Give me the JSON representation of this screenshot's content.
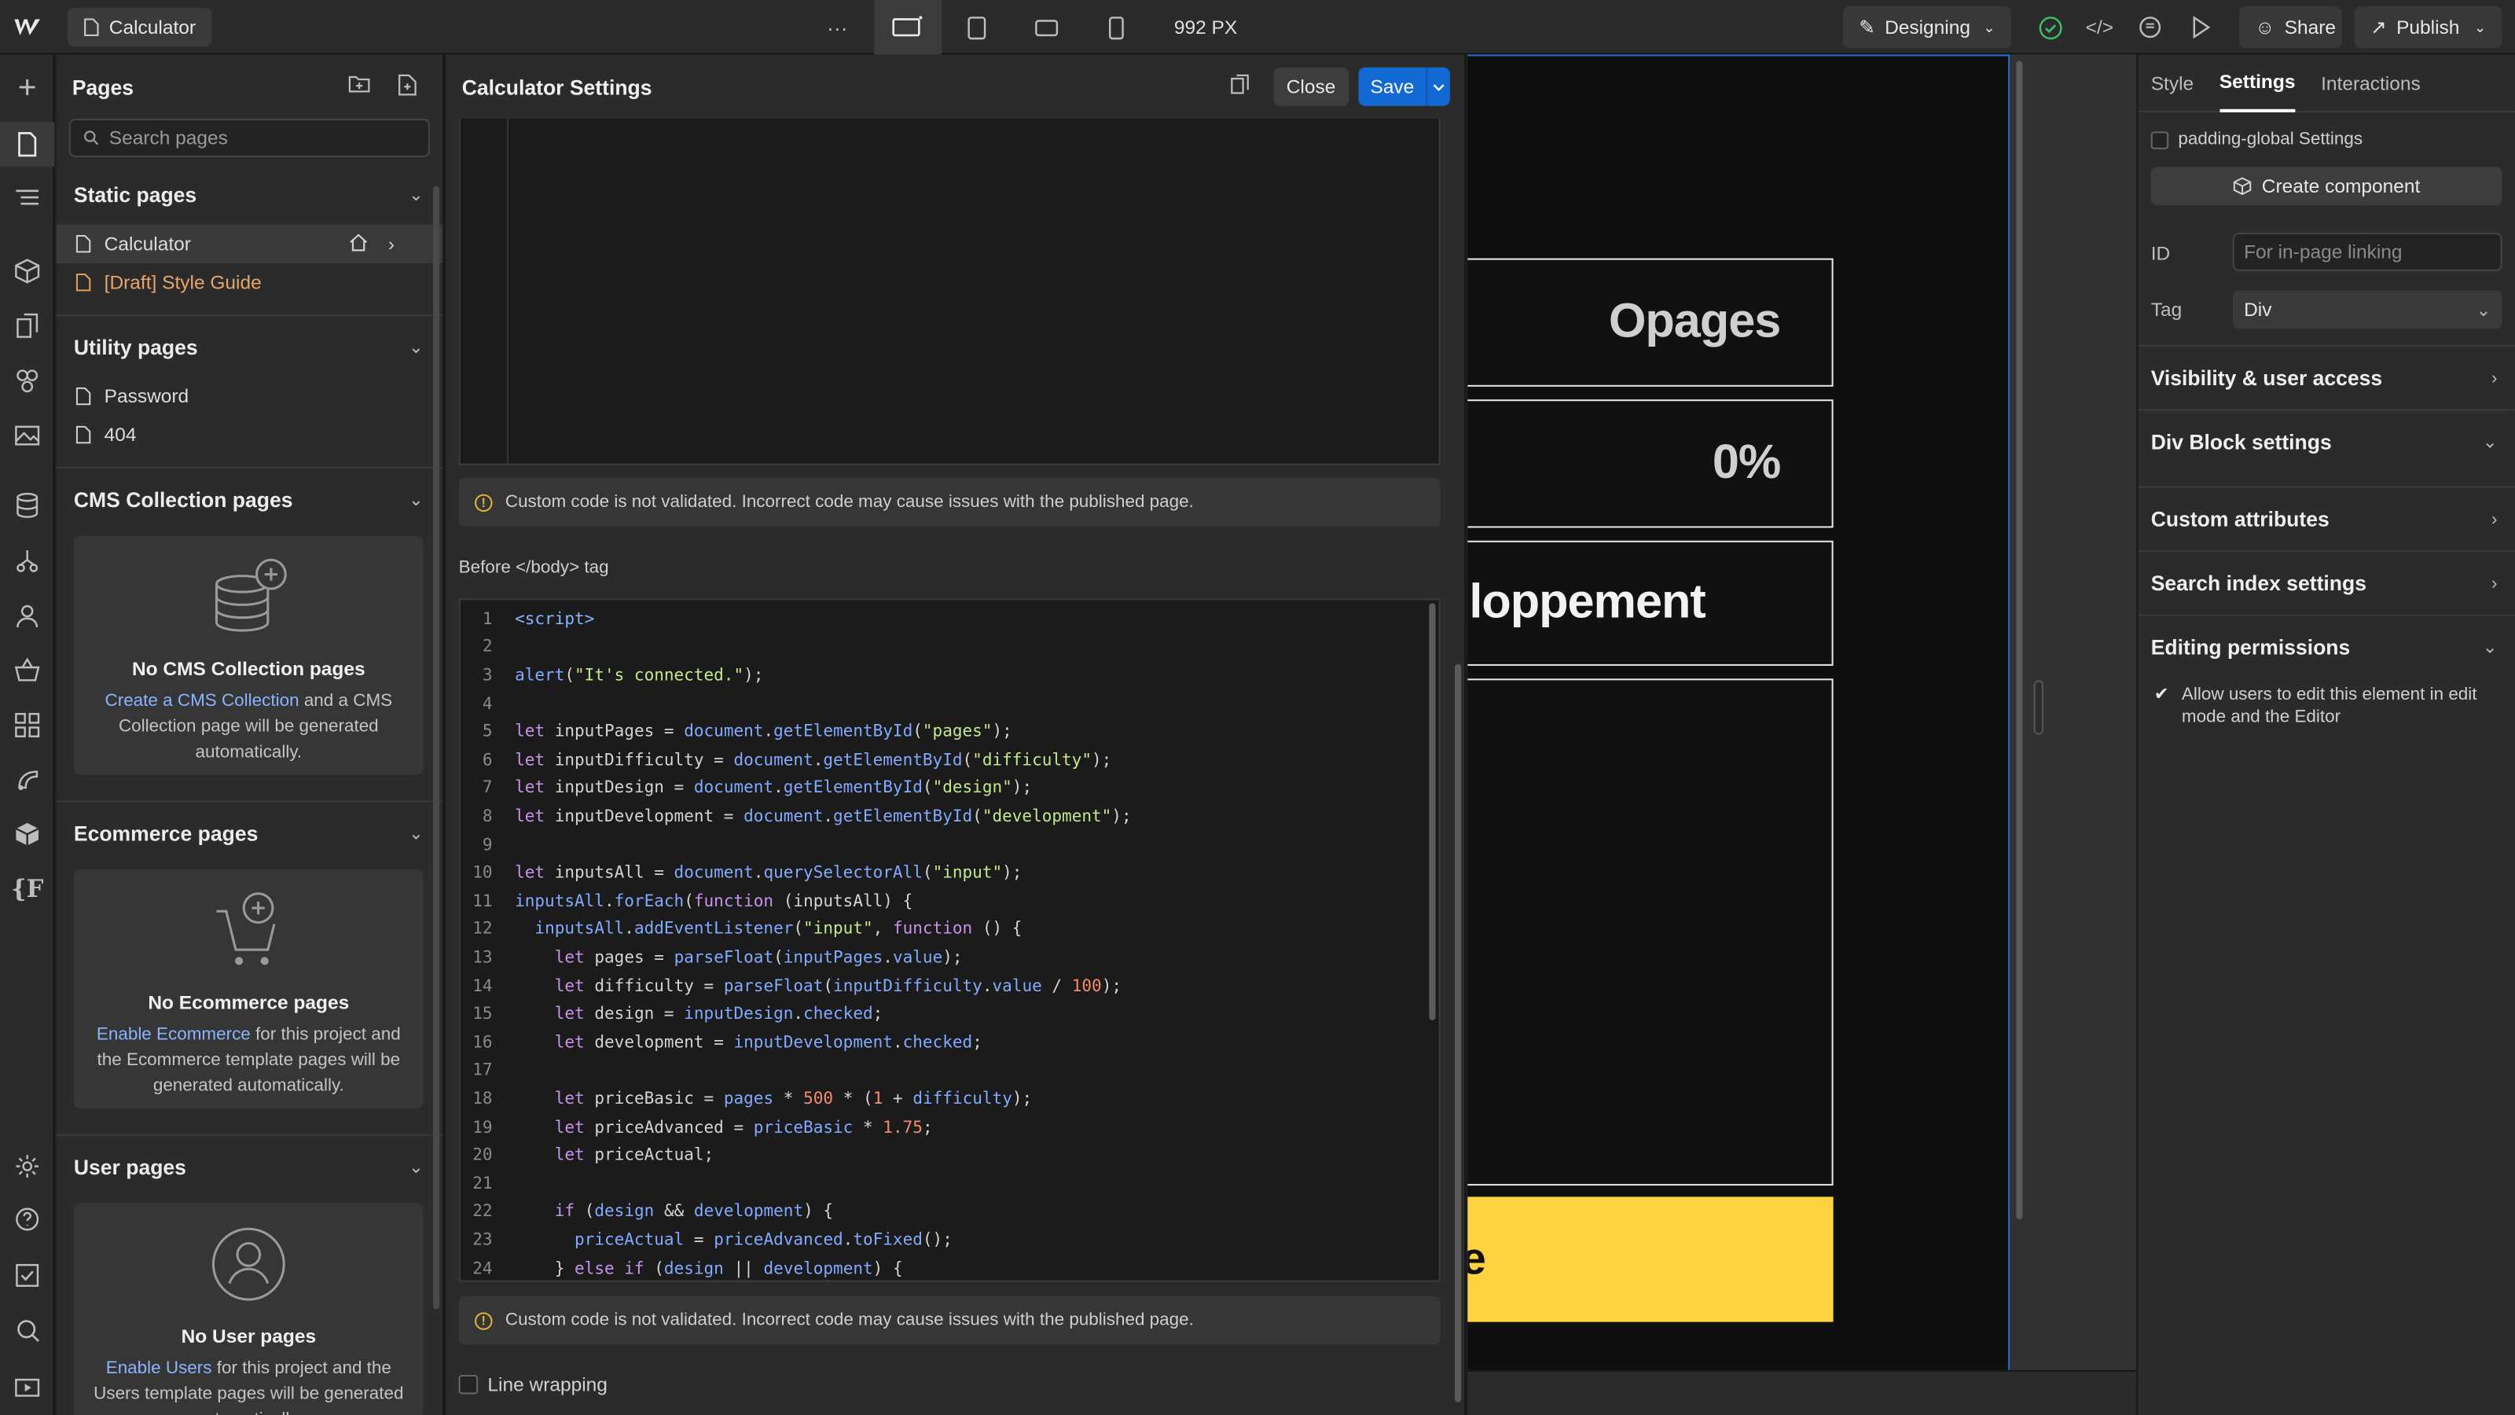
{
  "topbar": {
    "page_name": "Calculator",
    "more": "···",
    "width_readout": "992 PX",
    "mode": "Designing",
    "share": "Share",
    "publish": "Publish"
  },
  "pages_panel": {
    "title": "Pages",
    "search_placeholder": "Search pages",
    "static_title": "Static pages",
    "static_pages": [
      "Calculator",
      "[Draft] Style Guide"
    ],
    "utility_title": "Utility pages",
    "utility_pages": [
      "Password",
      "404"
    ],
    "cms_title": "CMS Collection pages",
    "cms_empty_title": "No CMS Collection pages",
    "cms_link": "Create a CMS Collection",
    "cms_text": " and a CMS Collection page will be generated automatically.",
    "ecom_title": "Ecommerce pages",
    "ecom_empty_title": "No Ecommerce pages",
    "ecom_link": "Enable Ecommerce",
    "ecom_text": " for this project and the Ecommerce template pages will be generated automatically.",
    "user_title": "User pages",
    "user_empty_title": "No User pages",
    "user_link": "Enable Users",
    "user_text": " for this project and the Users template pages will be generated automatically."
  },
  "modal": {
    "title": "Calculator Settings",
    "close": "Close",
    "save": "Save",
    "warning": "Custom code is not validated. Incorrect code may cause issues with the published page.",
    "before_body_label": "Before </body> tag",
    "line_wrapping": "Line wrapping",
    "code_lines": [
      "<script>",
      "",
      "alert(\"It's connected.\");",
      "",
      "let inputPages = document.getElementById(\"pages\");",
      "let inputDifficulty = document.getElementById(\"difficulty\");",
      "let inputDesign = document.getElementById(\"design\");",
      "let inputDevelopment = document.getElementById(\"development\");",
      "",
      "let inputsAll = document.querySelectorAll(\"input\");",
      "inputsAll.forEach(function (inputsAll) {",
      "  inputsAll.addEventListener(\"input\", function () {",
      "    let pages = parseFloat(inputPages.value);",
      "    let difficulty = parseFloat(inputDifficulty.value / 100);",
      "    let design = inputDesign.checked;",
      "    let development = inputDevelopment.checked;",
      "",
      "    let priceBasic = pages * 500 * (1 + difficulty);",
      "    let priceAdvanced = priceBasic * 1.75;",
      "    let priceActual;",
      "",
      "    if (design && development) {",
      "      priceActual = priceAdvanced.toFixed();",
      "    } else if (design || development) {"
    ]
  },
  "canvas": {
    "box1": "Opages",
    "box2": "0%",
    "box3": "loppement",
    "ybar": "e"
  },
  "right_panel": {
    "tabs": [
      "Style",
      "Settings",
      "Interactions"
    ],
    "component_settings": "padding-global Settings",
    "create_component": "Create component",
    "id_label": "ID",
    "id_placeholder": "For in-page linking",
    "tag_label": "Tag",
    "tag_value": "Div",
    "sections": [
      "Visibility & user access",
      "Div Block settings",
      "Custom attributes",
      "Search index settings",
      "Editing permissions"
    ],
    "permission_text": "Allow users to edit this element in edit mode and the Editor"
  },
  "colors": {
    "accent": "#1369d4",
    "yellow": "#ffd23f",
    "link": "#8ab4ff"
  }
}
